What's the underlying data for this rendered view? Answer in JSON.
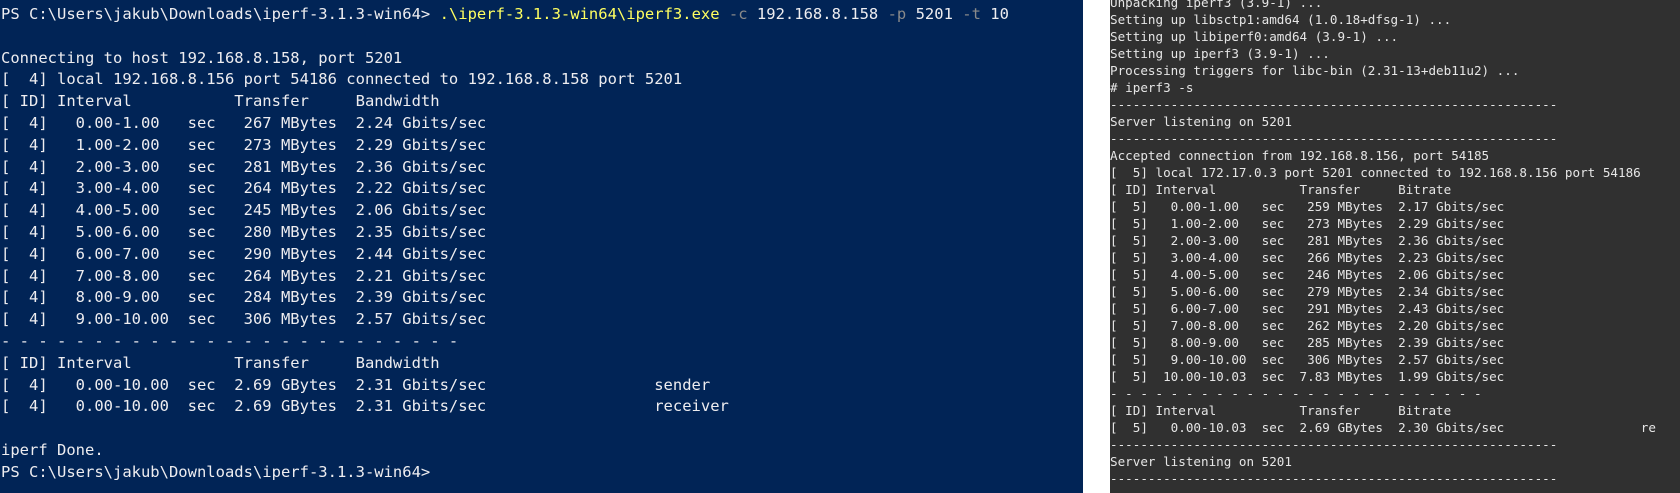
{
  "powershell": {
    "prompt_line": {
      "prompt": "PS C:\\Users\\jakub\\Downloads\\iperf-3.1.3-win64> ",
      "exe": ".\\iperf-3.1.3-win64\\iperf3.exe",
      "seg1": " ",
      "flag_c": "-c",
      "arg_c": " 192.168.8.158 ",
      "flag_p": "-p",
      "arg_p": " 5201 ",
      "flag_t": "-t",
      "arg_t": " 10"
    },
    "lines": [
      "",
      "Connecting to host 192.168.8.158, port 5201",
      "[  4] local 192.168.8.156 port 54186 connected to 192.168.8.158 port 5201",
      "[ ID] Interval           Transfer     Bandwidth",
      "[  4]   0.00-1.00   sec   267 MBytes  2.24 Gbits/sec",
      "[  4]   1.00-2.00   sec   273 MBytes  2.29 Gbits/sec",
      "[  4]   2.00-3.00   sec   281 MBytes  2.36 Gbits/sec",
      "[  4]   3.00-4.00   sec   264 MBytes  2.22 Gbits/sec",
      "[  4]   4.00-5.00   sec   245 MBytes  2.06 Gbits/sec",
      "[  4]   5.00-6.00   sec   280 MBytes  2.35 Gbits/sec",
      "[  4]   6.00-7.00   sec   290 MBytes  2.44 Gbits/sec",
      "[  4]   7.00-8.00   sec   264 MBytes  2.21 Gbits/sec",
      "[  4]   8.00-9.00   sec   284 MBytes  2.39 Gbits/sec",
      "[  4]   9.00-10.00  sec   306 MBytes  2.57 Gbits/sec",
      "- - - - - - - - - - - - - - - - - - - - - - - - -",
      "[ ID] Interval           Transfer     Bandwidth",
      "[  4]   0.00-10.00  sec  2.69 GBytes  2.31 Gbits/sec                  sender",
      "[  4]   0.00-10.00  sec  2.69 GBytes  2.31 Gbits/sec                  receiver",
      "",
      "iperf Done.",
      "PS C:\\Users\\jakub\\Downloads\\iperf-3.1.3-win64>"
    ]
  },
  "terminal": {
    "lines": [
      "Unpacking iperf3 (3.9-1) ...",
      "Setting up libsctp1:amd64 (1.0.18+dfsg-1) ...",
      "Setting up libiperf0:amd64 (3.9-1) ...",
      "Setting up iperf3 (3.9-1) ...",
      "Processing triggers for libc-bin (2.31-13+deb11u2) ...",
      "# iperf3 -s",
      "-----------------------------------------------------------",
      "Server listening on 5201",
      "-----------------------------------------------------------",
      "Accepted connection from 192.168.8.156, port 54185",
      "[  5] local 172.17.0.3 port 5201 connected to 192.168.8.156 port 54186",
      "[ ID] Interval           Transfer     Bitrate",
      "[  5]   0.00-1.00   sec   259 MBytes  2.17 Gbits/sec",
      "[  5]   1.00-2.00   sec   273 MBytes  2.29 Gbits/sec",
      "[  5]   2.00-3.00   sec   281 MBytes  2.36 Gbits/sec",
      "[  5]   3.00-4.00   sec   266 MBytes  2.23 Gbits/sec",
      "[  5]   4.00-5.00   sec   246 MBytes  2.06 Gbits/sec",
      "[  5]   5.00-6.00   sec   279 MBytes  2.34 Gbits/sec",
      "[  5]   6.00-7.00   sec   291 MBytes  2.43 Gbits/sec",
      "[  5]   7.00-8.00   sec   262 MBytes  2.20 Gbits/sec",
      "[  5]   8.00-9.00   sec   285 MBytes  2.39 Gbits/sec",
      "[  5]   9.00-10.00  sec   306 MBytes  2.57 Gbits/sec",
      "[  5]  10.00-10.03  sec  7.83 MBytes  1.99 Gbits/sec",
      "- - - - - - - - - - - - - - - - - - - - - - - - -",
      "[ ID] Interval           Transfer     Bitrate",
      "[  5]   0.00-10.03  sec  2.69 GBytes  2.30 Gbits/sec                  re",
      "-----------------------------------------------------------",
      "Server listening on 5201",
      "-----------------------------------------------------------"
    ]
  },
  "colors": {
    "powershell_bg": "#012456",
    "powershell_fg": "#eeedf0",
    "powershell_exe": "#ffff60",
    "powershell_flag": "#8a8a8a",
    "terminal_bg": "#303030",
    "terminal_fg": "#e6e6e6"
  }
}
